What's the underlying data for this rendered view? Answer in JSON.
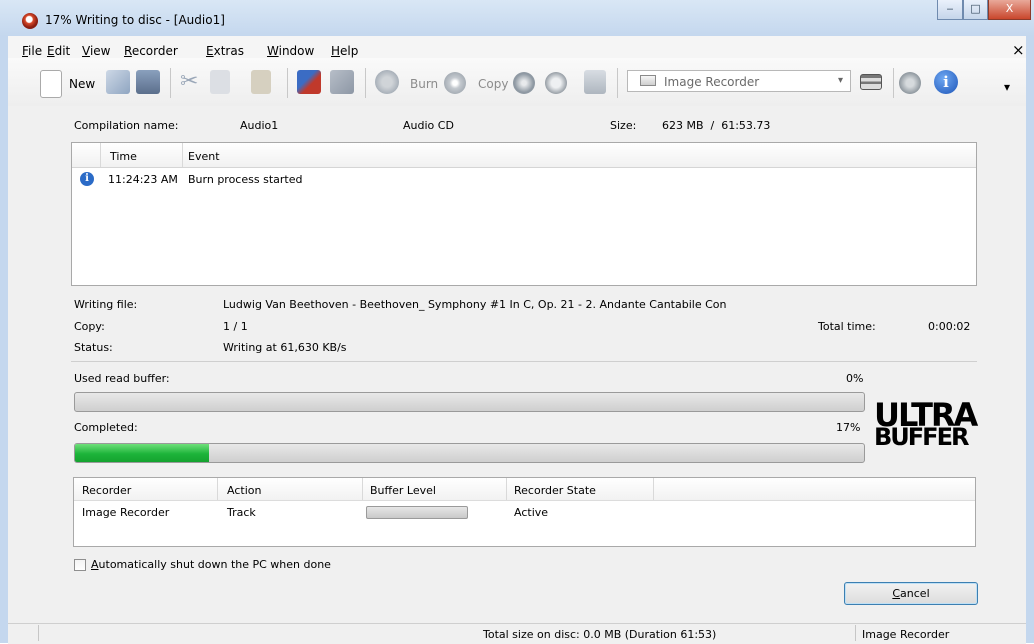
{
  "window": {
    "title": "17% Writing to disc - [Audio1]",
    "minimize": "‒",
    "maximize": "□",
    "close": "X"
  },
  "menu": {
    "items": [
      {
        "label": "File",
        "key": "F",
        "rest": "ile"
      },
      {
        "label": "Edit",
        "key": "E",
        "rest": "dit"
      },
      {
        "label": "View",
        "key": "V",
        "rest": "iew"
      },
      {
        "label": "Recorder",
        "key": "R",
        "rest": "ecorder"
      },
      {
        "label": "Extras",
        "key": "E",
        "rest": "xtras"
      },
      {
        "label": "Window",
        "key": "W",
        "rest": "indow"
      },
      {
        "label": "Help",
        "key": "H",
        "rest": "elp"
      }
    ],
    "close": "×"
  },
  "toolbar": {
    "new_label": "New",
    "burn_label": "Burn",
    "copy_label": "Copy",
    "recorder_select": "Image Recorder",
    "combo_arrow": "▾",
    "overflow": "▾"
  },
  "compilation": {
    "name_label": "Compilation name:",
    "name_value": "Audio1",
    "type": "Audio CD",
    "size_label": "Size:",
    "size_value": "623 MB  /  61:53.73"
  },
  "log": {
    "columns": [
      "Time",
      "Event"
    ],
    "rows": [
      {
        "icon": "info-icon",
        "time": "11:24:23 AM",
        "event": "Burn process started"
      }
    ]
  },
  "details": {
    "writing_file_label": "Writing file:",
    "writing_file_value": "Ludwig Van Beethoven - Beethoven_ Symphony #1 In C, Op. 21 - 2. Andante Cantabile Con",
    "copy_label": "Copy:",
    "copy_value": "1 / 1",
    "total_time_label": "Total time:",
    "total_time_value": "0:00:02",
    "status_label": "Status:",
    "status_value": "Writing at 61,630 KB/s"
  },
  "progress": {
    "read_buffer_label": "Used read buffer:",
    "read_buffer_pct_text": "0%",
    "read_buffer_fraction": 0.0,
    "completed_label": "Completed:",
    "completed_pct_text": "17%",
    "completed_fraction": 0.17
  },
  "logo": {
    "line1": "ULTRA",
    "line2": "BUFFER"
  },
  "recorders": {
    "columns": [
      "Recorder",
      "Action",
      "Buffer Level",
      "Recorder State"
    ],
    "rows": [
      {
        "recorder": "Image Recorder",
        "action": "Track",
        "buffer_fraction": 0.0,
        "state": "Active"
      }
    ]
  },
  "shutdown": {
    "key": "A",
    "rest": "utomatically shut down the PC when done",
    "checked": false
  },
  "cancel": {
    "key": "C",
    "rest": "ancel"
  },
  "statusbar": {
    "total": "Total size on disc: 0.0 MB (Duration 61:53)",
    "recorder": "Image Recorder"
  },
  "colors": {
    "progress_green": "#1db43a",
    "accent_blue": "#2b6bc7"
  }
}
